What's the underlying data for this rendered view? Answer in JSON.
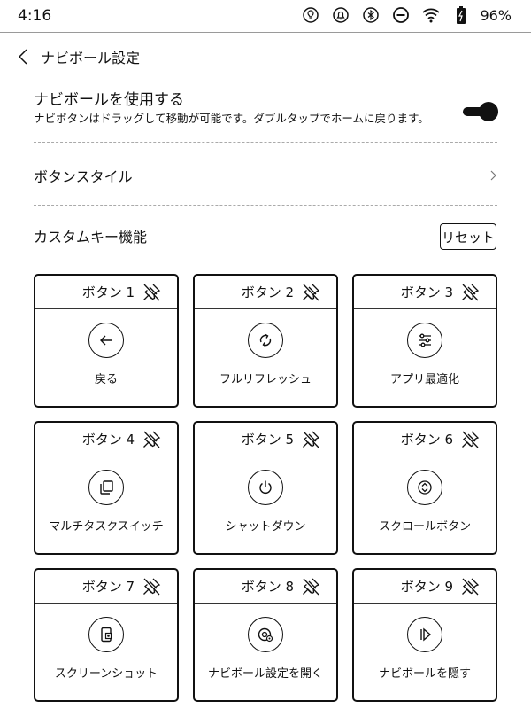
{
  "status": {
    "time": "4:16",
    "battery": "96%"
  },
  "header": {
    "title": "ナビボール設定"
  },
  "navi_ball": {
    "title": "ナビボールを使用する",
    "description": "ナビボタンはドラッグして移動が可能です。ダブルタップでホームに戻ります。",
    "enabled": true
  },
  "button_style": {
    "label": "ボタンスタイル"
  },
  "custom_keys": {
    "label": "カスタムキー機能",
    "reset_label": "リセット",
    "buttons": [
      {
        "title": "ボタン 1",
        "label": "戻る",
        "icon": "back-arrow-icon"
      },
      {
        "title": "ボタン 2",
        "label": "フルリフレッシュ",
        "icon": "refresh-icon"
      },
      {
        "title": "ボタン 3",
        "label": "アプリ最適化",
        "icon": "sliders-icon"
      },
      {
        "title": "ボタン 4",
        "label": "マルチタスクスイッチ",
        "icon": "multitask-icon"
      },
      {
        "title": "ボタン 5",
        "label": "シャットダウン",
        "icon": "power-icon"
      },
      {
        "title": "ボタン 6",
        "label": "スクロールボタン",
        "icon": "scroll-icon"
      },
      {
        "title": "ボタン 7",
        "label": "スクリーンショット",
        "icon": "screenshot-icon"
      },
      {
        "title": "ボタン 8",
        "label": "ナビボール設定を開く",
        "icon": "settings-icon"
      },
      {
        "title": "ボタン 9",
        "label": "ナビボールを隠す",
        "icon": "hide-icon"
      }
    ]
  }
}
